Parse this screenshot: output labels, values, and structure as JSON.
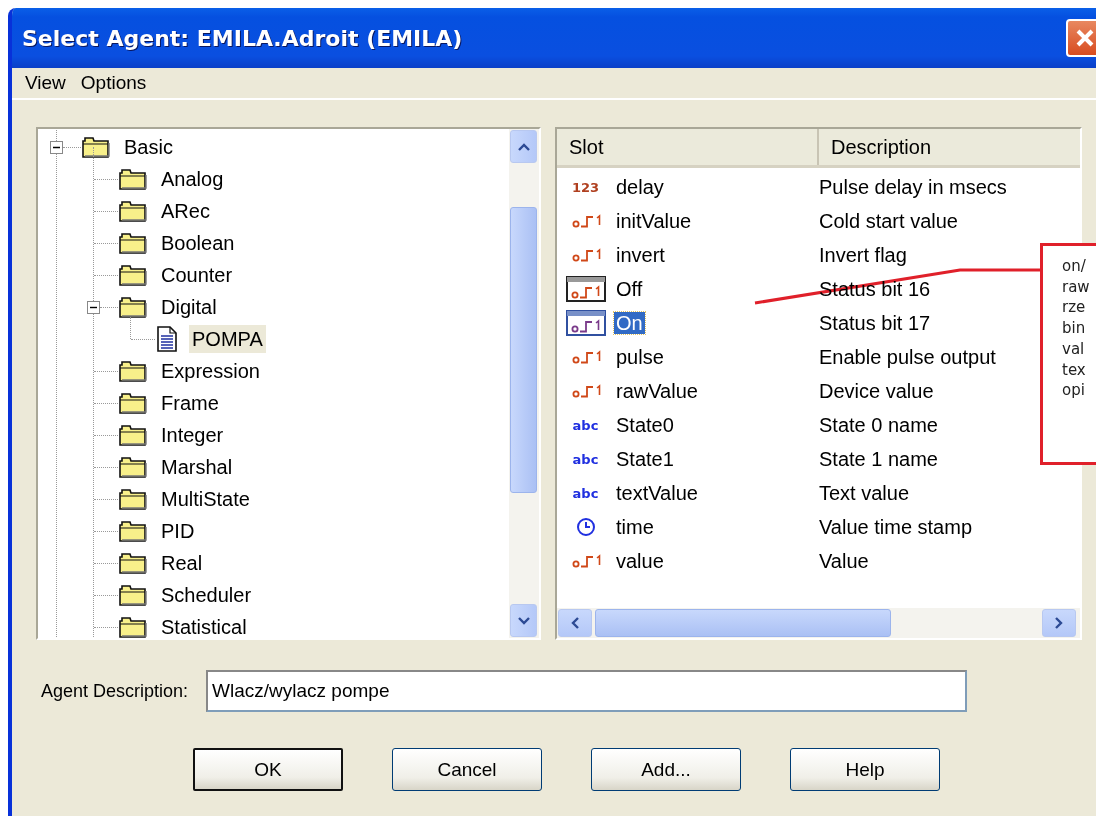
{
  "window": {
    "title": "Select Agent: EMILA.Adroit (EMILA)"
  },
  "menu": [
    {
      "label": "View"
    },
    {
      "label": "Options"
    }
  ],
  "tree": [
    {
      "label": "Basic",
      "kind": "folder",
      "expanded": true,
      "selected": false,
      "children": [
        {
          "label": "Analog",
          "kind": "folder",
          "selected": false
        },
        {
          "label": "ARec",
          "kind": "folder",
          "selected": false
        },
        {
          "label": "Boolean",
          "kind": "folder",
          "selected": false
        },
        {
          "label": "Counter",
          "kind": "folder",
          "selected": false
        },
        {
          "label": "Digital",
          "kind": "folder",
          "expanded": true,
          "selected": false,
          "children": [
            {
              "label": "POMPA",
              "kind": "document",
              "selected": true
            }
          ]
        },
        {
          "label": "Expression",
          "kind": "folder",
          "selected": false
        },
        {
          "label": "Frame",
          "kind": "folder",
          "selected": false
        },
        {
          "label": "Integer",
          "kind": "folder",
          "selected": false
        },
        {
          "label": "Marshal",
          "kind": "folder",
          "selected": false
        },
        {
          "label": "MultiState",
          "kind": "folder",
          "selected": false
        },
        {
          "label": "PID",
          "kind": "folder",
          "selected": false
        },
        {
          "label": "Real",
          "kind": "folder",
          "selected": false
        },
        {
          "label": "Scheduler",
          "kind": "folder",
          "selected": false
        },
        {
          "label": "Statistical",
          "kind": "folder",
          "selected": false
        }
      ]
    }
  ],
  "slots": {
    "columns": [
      "Slot",
      "Description"
    ],
    "rows": [
      {
        "kind": "number",
        "badge": "123",
        "slot": "delay",
        "description": "Pulse delay in msecs",
        "selected": false
      },
      {
        "kind": "binary",
        "slot": "initValue",
        "description": "Cold start value",
        "selected": false
      },
      {
        "kind": "binary",
        "slot": "invert",
        "description": "Invert flag",
        "selected": false
      },
      {
        "kind": "status",
        "slot": "Off",
        "description": "Status bit 16",
        "selected": false
      },
      {
        "kind": "status",
        "slot": "On",
        "description": "Status bit 17",
        "selected": true
      },
      {
        "kind": "binary",
        "slot": "pulse",
        "description": "Enable pulse output",
        "selected": false
      },
      {
        "kind": "binary",
        "slot": "rawValue",
        "description": "Device value",
        "selected": false
      },
      {
        "kind": "text",
        "badge": "abc",
        "slot": "State0",
        "description": "State 0 name",
        "selected": false
      },
      {
        "kind": "text",
        "badge": "abc",
        "slot": "State1",
        "description": "State 1 name",
        "selected": false
      },
      {
        "kind": "text",
        "badge": "abc",
        "slot": "textValue",
        "description": "Text value",
        "selected": false
      },
      {
        "kind": "time",
        "slot": "time",
        "description": "Value time stamp",
        "selected": false
      },
      {
        "kind": "binary",
        "slot": "value",
        "description": "Value",
        "selected": false
      }
    ]
  },
  "agent_description": {
    "label": "Agent Description:",
    "value": "Wlacz/wylacz pompe"
  },
  "buttons": [
    {
      "label": "OK",
      "default": true
    },
    {
      "label": "Cancel",
      "default": false
    },
    {
      "label": "Add...",
      "default": false
    },
    {
      "label": "Help",
      "default": false
    }
  ],
  "callout": {
    "lines": [
      "on/",
      "raw",
      "rze",
      "bin",
      "val",
      "tex",
      "opi"
    ]
  }
}
